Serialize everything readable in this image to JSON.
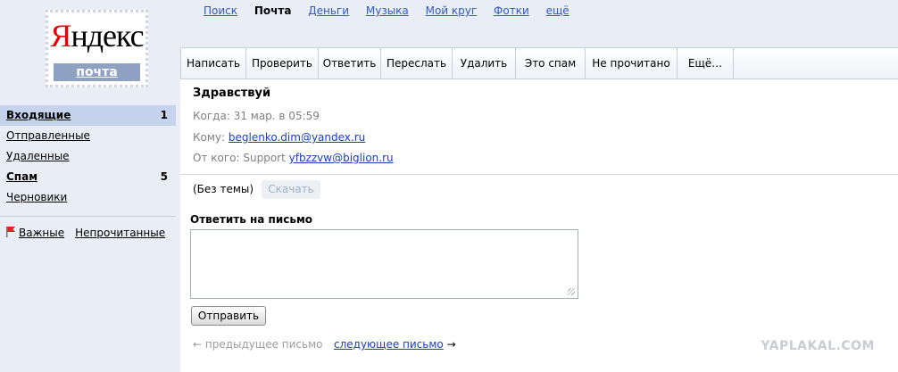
{
  "topnav": {
    "items": [
      "Поиск",
      "Почта",
      "Деньги",
      "Музыка",
      "Мой круг",
      "Фотки",
      "ещё"
    ],
    "active_index": 1
  },
  "logo": {
    "brand_first": "Я",
    "brand_rest": "ндекс",
    "service": "почта"
  },
  "sidebar": {
    "folders": [
      {
        "name": "Входящие",
        "count": "1"
      },
      {
        "name": "Отправленные",
        "count": ""
      },
      {
        "name": "Удаленные",
        "count": ""
      },
      {
        "name": "Спам",
        "count": "5"
      },
      {
        "name": "Черновики",
        "count": ""
      }
    ],
    "labels": [
      "Важные",
      "Непрочитанные"
    ],
    "flag_color": "#e8201e"
  },
  "toolbar": {
    "buttons": [
      "Написать",
      "Проверить",
      "Ответить",
      "Переслать",
      "Удалить",
      "Это спам",
      "Не прочитано",
      "Ещё…"
    ]
  },
  "message": {
    "subject": "Здравствуй",
    "when_label": "Когда:",
    "when_value": "31 мар. в 05:59",
    "to_label": "Кому:",
    "to_email": "beglenko.dim@yandex.ru",
    "from_label": "От кого:",
    "from_name": "Support",
    "from_email": "yfbzzvw@biglion.ru",
    "no_subject": "(Без темы)",
    "download_label": "Скачать"
  },
  "reply": {
    "title": "Ответить на письмо",
    "value": "",
    "send_label": "Отправить"
  },
  "pager": {
    "prev_arrow": "←",
    "prev": "предыдущее письмо",
    "next": "следующее письмо",
    "next_arrow": "→"
  },
  "watermark": "YAPLAKAL.COM",
  "colors": {
    "background": "#e9eef6",
    "selected_folder": "#c5d3ec",
    "link": "#1a3dc1",
    "logo_red": "#e8000b"
  }
}
